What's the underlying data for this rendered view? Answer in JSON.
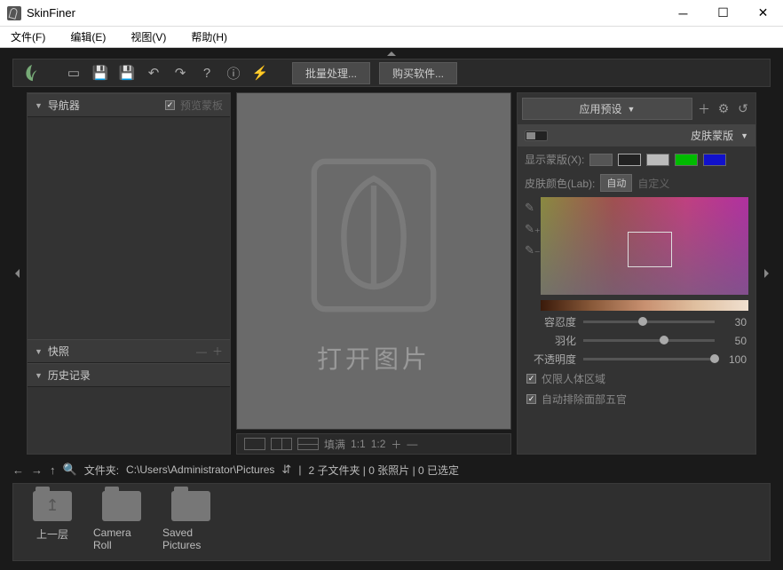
{
  "window": {
    "title": "SkinFiner"
  },
  "menu": {
    "file": "文件(F)",
    "edit": "编辑(E)",
    "view": "视图(V)",
    "help": "帮助(H)"
  },
  "toolbar": {
    "batch": "批量处理...",
    "buy": "购买软件..."
  },
  "left": {
    "navigator": "导航器",
    "preview_mask": "预览蒙板",
    "snapshot": "快照",
    "history": "历史记录"
  },
  "center": {
    "open_image": "打开图片",
    "fit": "填满",
    "one_to_one": "1:1",
    "one_to_two": "1:2"
  },
  "right": {
    "apply_preset": "应用预设",
    "skin_mask": "皮肤蒙版",
    "show_mask": "显示蒙版(X):",
    "skin_color": "皮肤颜色(Lab):",
    "auto": "自动",
    "custom": "自定义",
    "tolerance": {
      "label": "容忍度",
      "value": "30",
      "pos": 42
    },
    "feather": {
      "label": "羽化",
      "value": "50",
      "pos": 58
    },
    "opacity": {
      "label": "不透明度",
      "value": "100",
      "pos": 100
    },
    "limit_body": "仅限人体区域",
    "auto_exclude": "自动排除面部五官"
  },
  "status": {
    "folder_label": "文件夹:",
    "path": "C:\\Users\\Administrator\\Pictures",
    "summary": "2 子文件夹 | 0 张照片 | 0 已选定"
  },
  "browser": {
    "up": "上一层",
    "camera_roll": "Camera Roll",
    "saved": "Saved Pictures"
  }
}
